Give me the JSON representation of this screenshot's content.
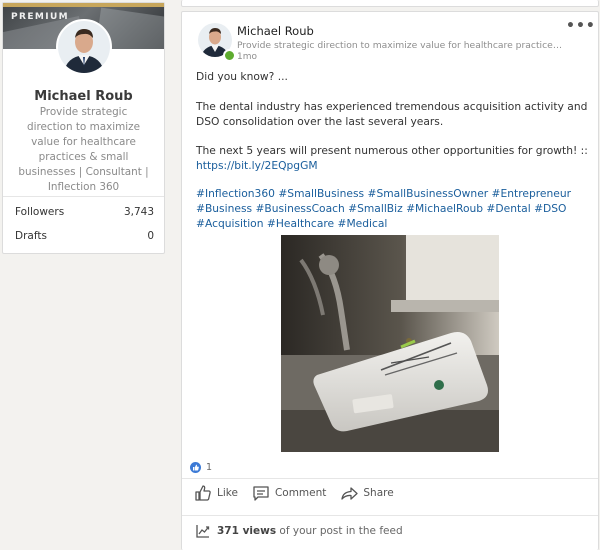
{
  "profile": {
    "badge": "PREMIUM",
    "name": "Michael Roub",
    "headline": "Provide strategic direction to maximize value for healthcare practices & small businesses | Consultant | Inflection 360",
    "stats": [
      {
        "label": "Followers",
        "value": "3,743"
      },
      {
        "label": "Drafts",
        "value": "0"
      }
    ]
  },
  "post": {
    "author": "Michael Roub",
    "author_headline": "Provide strategic direction to maximize value for healthcare practices & small b...",
    "time": "1mo",
    "more_icon": "•••",
    "text1": "Did you know? ...",
    "text2": "The dental industry has experienced tremendous acquisition activity and DSO consolidation over the last several years.",
    "text3": "The next 5 years will present numerous other opportunities for growth! ::",
    "url": "https://bit.ly/2EQpgGM",
    "hashtags": "#Inflection360 #SmallBusiness #SmallBusinessOwner #Entrepreneur #Business #BusinessCoach #SmallBiz #MichaelRoub #Dental #DSO #Acquisition #Healthcare #Medical",
    "reaction_count": "1",
    "actions": {
      "like": "Like",
      "comment": "Comment",
      "share": "Share"
    },
    "views_count": "371 views",
    "views_suffix": " of your post in the feed"
  },
  "colors": {
    "link": "#1a5e9c",
    "online": "#5eac2f",
    "like": "#3c7ad6"
  }
}
